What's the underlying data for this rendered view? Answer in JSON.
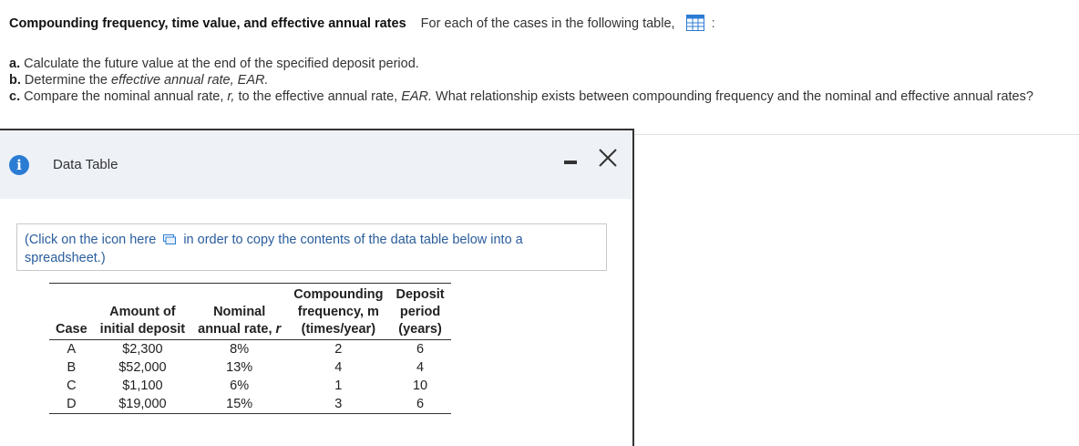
{
  "question": {
    "title": "Compounding frequency, time value, and effective annual rates",
    "intro": "For each of the cases in the following table,",
    "colon": ":",
    "table_icon": "table-grid-icon",
    "parts": [
      {
        "letter": "a.",
        "text": "Calculate the future value at the end of the specified deposit period."
      },
      {
        "letter": "b.",
        "text_plain": "Determine the ",
        "text_italic": "effective annual rate, EAR."
      },
      {
        "letter": "c.",
        "text_1": "Compare the nominal annual rate, ",
        "italic_r": "r,",
        "text_2": " to the effective annual rate, ",
        "italic_ear": "EAR.",
        "text_3": "  What relationship exists between compounding frequency and the nominal and effective annual rates?"
      }
    ]
  },
  "modal": {
    "title": "Data Table",
    "info_icon": "info-icon",
    "copy_note_1": "(Click on the icon here",
    "copy_note_2": "in order to copy the contents of the data table below into a spreadsheet.)",
    "table": {
      "headers": {
        "case": "Case",
        "amount_1": "Amount of",
        "amount_2": "initial deposit",
        "nominal_1": "Nominal",
        "nominal_2": "annual rate,",
        "nominal_r": "r",
        "comp_1": "Compounding",
        "comp_2": "frequency, m",
        "comp_3": "(times/year)",
        "dep_1": "Deposit",
        "dep_2": "period",
        "dep_3": "(years)"
      },
      "rows": [
        {
          "case": "A",
          "amount": "$2,300",
          "rate": "8%",
          "freq": "2",
          "period": "6"
        },
        {
          "case": "B",
          "amount": "$52,000",
          "rate": "13%",
          "freq": "4",
          "period": "4"
        },
        {
          "case": "C",
          "amount": "$1,100",
          "rate": "6%",
          "freq": "1",
          "period": "10"
        },
        {
          "case": "D",
          "amount": "$19,000",
          "rate": "15%",
          "freq": "3",
          "period": "6"
        }
      ]
    }
  },
  "colors": {
    "accent": "#2b7cd3",
    "header_bg": "#eef2f7",
    "link_text": "#2a5d9c"
  }
}
